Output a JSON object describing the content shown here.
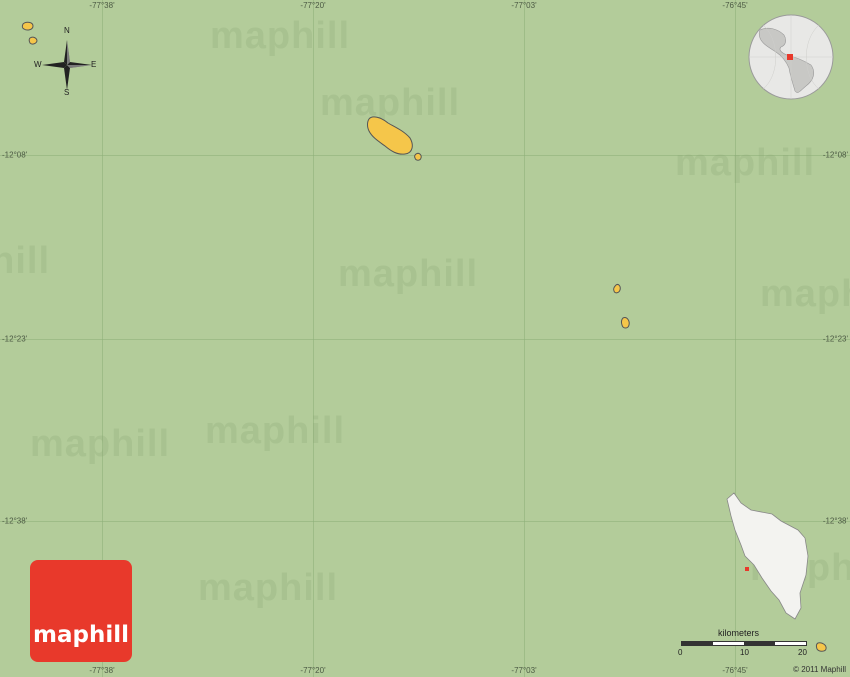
{
  "map": {
    "background_color": "#b3cc9a",
    "land_color": "#f5c64a",
    "inset_land_color": "#f3f3f0",
    "longitudes": [
      "-77°38'",
      "-77°20'",
      "-77°03'",
      "-76°45'"
    ],
    "latitudes": [
      "-12°08'",
      "-12°23'",
      "-12°38'"
    ],
    "watermark_text": "maphill",
    "compass": {
      "north": "N",
      "south": "S",
      "east": "E",
      "west": "W"
    },
    "scale": {
      "unit_label": "kilometers",
      "min": "0",
      "mid": "10",
      "max": "20"
    },
    "logo_text": "maphill",
    "copyright": "© 2011 Maphill",
    "logo_color": "#e8392b"
  }
}
